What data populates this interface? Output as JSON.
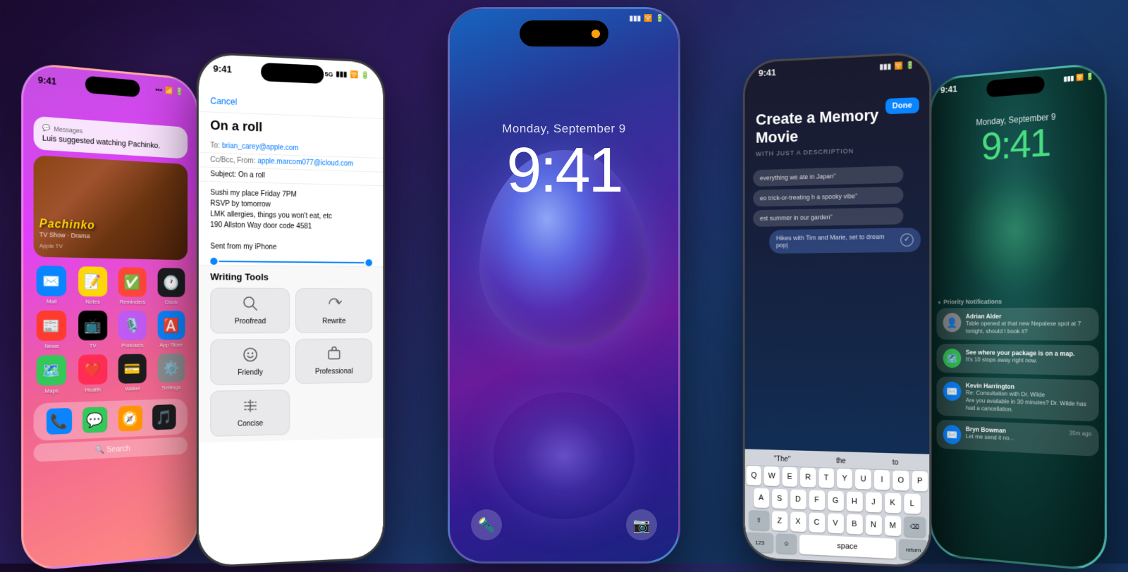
{
  "background": {
    "gradient_start": "#1a0a2e",
    "gradient_end": "#0d2a4e"
  },
  "phones": [
    {
      "id": "phone-1",
      "color": "purple-pink",
      "status_bar": {
        "time": "9:41",
        "signal": true,
        "wifi": true,
        "battery": true
      },
      "notification": {
        "text": "Luis suggested watching Pachinko.",
        "source": "Messages"
      },
      "show_title": "Pachinko",
      "show_genre": "TV Show · Drama",
      "show_source": "Apple TV",
      "apps": [
        {
          "label": "Mail",
          "emoji": "✉️",
          "bg": "#0A84FF"
        },
        {
          "label": "Notes",
          "emoji": "📝",
          "bg": "#FFD60A"
        },
        {
          "label": "Reminders",
          "emoji": "✅",
          "bg": "#FF453A"
        },
        {
          "label": "Clock",
          "emoji": "🕐",
          "bg": "#1C1C1E"
        },
        {
          "label": "News",
          "emoji": "📰",
          "bg": "#FF3B30"
        },
        {
          "label": "TV",
          "emoji": "📺",
          "bg": "#000"
        },
        {
          "label": "Podcasts",
          "emoji": "🎙️",
          "bg": "#BF5AF2"
        },
        {
          "label": "App Store",
          "emoji": "🅰️",
          "bg": "#0A84FF"
        },
        {
          "label": "Maps",
          "emoji": "🗺️",
          "bg": "#34C759"
        },
        {
          "label": "Health",
          "emoji": "❤️",
          "bg": "#FF2D55"
        },
        {
          "label": "Wallet",
          "emoji": "💳",
          "bg": "#1C1C1E"
        },
        {
          "label": "Settings",
          "emoji": "⚙️",
          "bg": "#8E8E93"
        }
      ],
      "search_placeholder": "Search"
    },
    {
      "id": "phone-2",
      "color": "dark-black",
      "status_bar": {
        "time": "9:41",
        "network": "5G",
        "signal": true,
        "wifi": true,
        "battery": true
      },
      "email": {
        "cancel": "Cancel",
        "subject_title": "On a roll",
        "to": "brian_carey@apple.com",
        "cc_from": "apple.marcom077@icloud.com",
        "subject": "On a roll",
        "body_lines": [
          "Sushi my place Friday 7PM",
          "RSVP by tomorrow",
          "LMK allergies, things you won't eat, etc",
          "190 Allston Way door code 4581",
          "",
          "Sent from my iPhone"
        ]
      },
      "writing_tools": {
        "title": "Writing Tools",
        "tools": [
          {
            "icon": "🔍",
            "label": "Proofread"
          },
          {
            "icon": "✏️",
            "label": "Rewrite"
          },
          {
            "icon": "🤝",
            "label": "Friendly"
          },
          {
            "icon": "💼",
            "label": "Professional"
          },
          {
            "icon": "➗",
            "label": "Concise"
          }
        ]
      }
    },
    {
      "id": "phone-3",
      "color": "blue-purple",
      "status_bar": {
        "time": "9:41",
        "signal": true,
        "wifi": true,
        "battery": true
      },
      "lock_screen": {
        "date": "Monday, September 9",
        "time": "9:41"
      }
    },
    {
      "id": "phone-4",
      "color": "dark-titanium",
      "status_bar": {
        "time": "9:41",
        "signal": true,
        "wifi": true,
        "battery": true
      },
      "done_button": "Done",
      "memory_movie": {
        "title": "Create a Memory Movie",
        "subtitle": "WITH JUST A DESCRIPTION"
      },
      "chat_prompts": [
        "everything we ate in Japan\"",
        "eo trick-or-treating h a spooky vibe\"",
        "est summer in our garden\""
      ],
      "current_input": "Hikes with Tim and Marie, set to dream pop|",
      "keyboard": {
        "rows": [
          [
            "Q",
            "W",
            "E",
            "R",
            "T",
            "Y",
            "U",
            "I",
            "O",
            "P"
          ],
          [
            "A",
            "S",
            "D",
            "F",
            "G",
            "H",
            "J",
            "K",
            "L"
          ],
          [
            "Z",
            "X",
            "C",
            "V",
            "B",
            "N",
            "M"
          ]
        ],
        "predictive": [
          "\"The\"",
          "the",
          "to"
        ]
      }
    },
    {
      "id": "phone-5",
      "color": "teal-green",
      "status_bar": {
        "time": "9:41",
        "signal": true,
        "wifi": true,
        "battery": true
      },
      "lock_screen": {
        "date": "Monday, September 9",
        "time": "9:41"
      },
      "priority_label": "Priority Notifications",
      "notifications": [
        {
          "sender": "Adrian Alder",
          "text": "Table opened at that new Nepalese spot at 7 tonight, should I book it?",
          "icon": "👤",
          "bg": "#8E8E93",
          "time": ""
        },
        {
          "sender": "See where your package is on a map.",
          "text": "It's 10 stops away right now.",
          "icon": "🗺️",
          "bg": "#34C759",
          "time": ""
        },
        {
          "sender": "Kevin Harrington",
          "text": "Re: Consultation with Dr. Wilde\nAre you available in 30 minutes? Dr. Wilde has had a cancellation.",
          "icon": "✉️",
          "bg": "#0A84FF",
          "time": ""
        },
        {
          "sender": "Bryn Bowman",
          "text": "Let me send it no...",
          "icon": "✉️",
          "bg": "#0A84FF",
          "time": "35m ago"
        }
      ]
    }
  ]
}
